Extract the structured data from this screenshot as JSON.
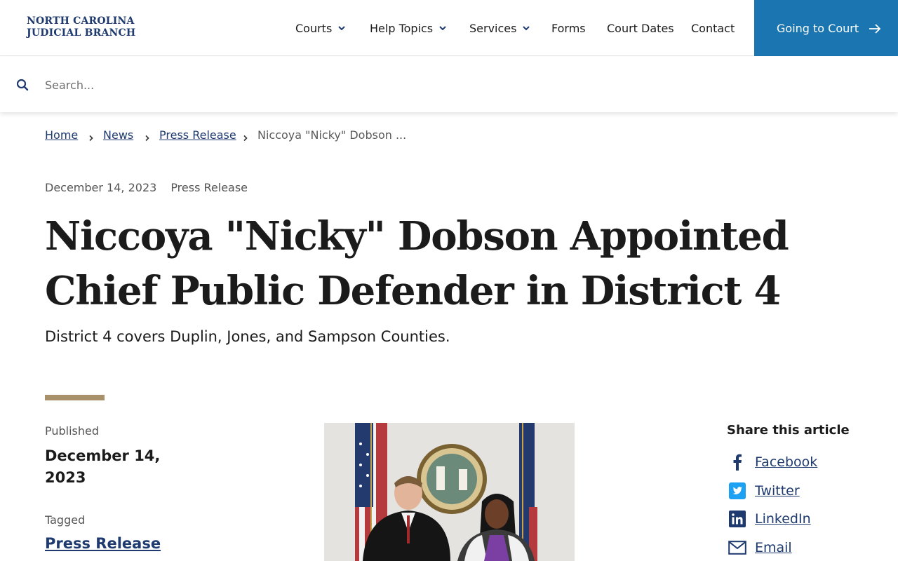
{
  "header": {
    "logo_line1": "NORTH CAROLINA",
    "logo_line2": "JUDICIAL BRANCH",
    "nav": [
      {
        "label": "Courts",
        "has_dropdown": true
      },
      {
        "label": "Help Topics",
        "has_dropdown": true
      },
      {
        "label": "Services",
        "has_dropdown": true
      },
      {
        "label": "Forms",
        "has_dropdown": false
      },
      {
        "label": "Court Dates",
        "has_dropdown": false
      },
      {
        "label": "Contact",
        "has_dropdown": false
      }
    ],
    "cta_label": "Going to Court",
    "cta_color": "#1a75b0"
  },
  "search": {
    "placeholder": "Search..."
  },
  "breadcrumb": {
    "items": [
      "Home",
      "News",
      "Press Release"
    ],
    "current": "Niccoya \"Nicky\" Dobson ..."
  },
  "article": {
    "date": "December 14, 2023",
    "category": "Press Release",
    "title": "Niccoya \"Nicky\" Dobson Appointed Chief Public Defender in District 4",
    "subtitle": "District 4 covers Duplin, Jones, and Sampson Counties.",
    "accent_color": "#a8916a",
    "published_label": "Published",
    "published_date": "December 14, 2023",
    "tagged_label": "Tagged",
    "tag": "Press Release"
  },
  "share": {
    "title": "Share this article",
    "items": [
      {
        "label": "Facebook",
        "icon": "facebook-icon"
      },
      {
        "label": "Twitter",
        "icon": "twitter-icon"
      },
      {
        "label": "LinkedIn",
        "icon": "linkedin-icon"
      },
      {
        "label": "Email",
        "icon": "email-icon"
      }
    ]
  },
  "colors": {
    "link": "#1e3a6e",
    "brand": "#1e3a6e"
  }
}
